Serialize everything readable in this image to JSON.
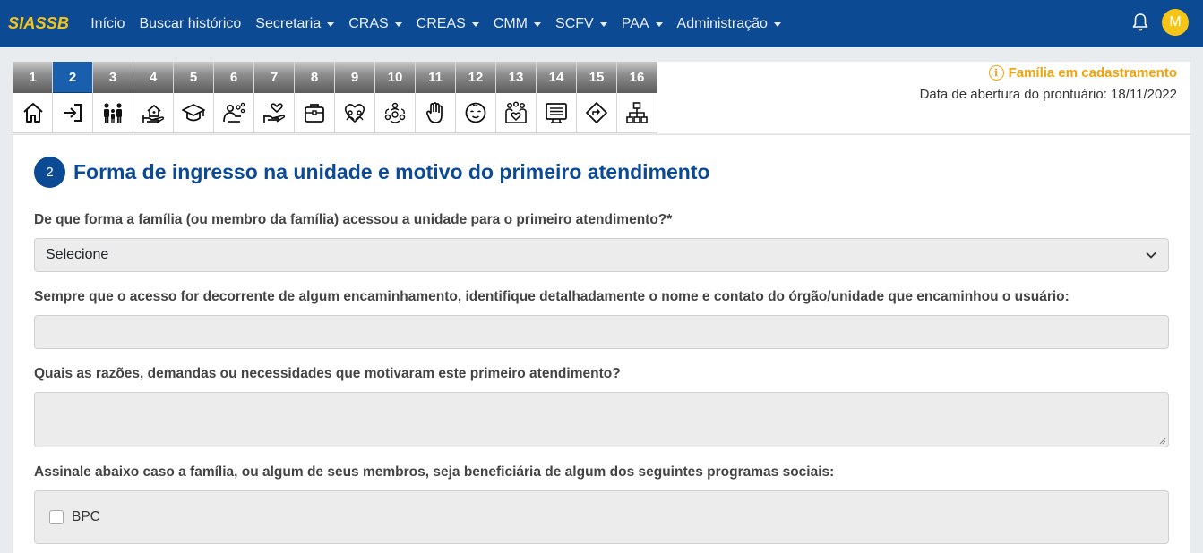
{
  "navbar": {
    "brand": "SIASSB",
    "items": [
      {
        "label": "Início",
        "dropdown": false
      },
      {
        "label": "Buscar histórico",
        "dropdown": false
      },
      {
        "label": "Secretaria",
        "dropdown": true
      },
      {
        "label": "CRAS",
        "dropdown": true
      },
      {
        "label": "CREAS",
        "dropdown": true
      },
      {
        "label": "CMM",
        "dropdown": true
      },
      {
        "label": "SCFV",
        "dropdown": true
      },
      {
        "label": "PAA",
        "dropdown": true
      },
      {
        "label": "Administração",
        "dropdown": true
      }
    ],
    "avatar_initial": "M",
    "bell_icon": "bell-icon"
  },
  "steps": [
    {
      "num": "1",
      "icon": "home-icon"
    },
    {
      "num": "2",
      "icon": "sign-in-icon",
      "active": true
    },
    {
      "num": "3",
      "icon": "family-icon"
    },
    {
      "num": "4",
      "icon": "house-hand-icon"
    },
    {
      "num": "5",
      "icon": "graduation-cap-icon"
    },
    {
      "num": "6",
      "icon": "health-icon"
    },
    {
      "num": "7",
      "icon": "hand-heart-icon"
    },
    {
      "num": "8",
      "icon": "briefcase-icon"
    },
    {
      "num": "9",
      "icon": "community-icon"
    },
    {
      "num": "10",
      "icon": "network-people-icon"
    },
    {
      "num": "11",
      "icon": "stop-hand-icon"
    },
    {
      "num": "12",
      "icon": "baby-face-icon"
    },
    {
      "num": "13",
      "icon": "people-heart-icon"
    },
    {
      "num": "14",
      "icon": "list-board-icon"
    },
    {
      "num": "15",
      "icon": "direction-sign-icon"
    },
    {
      "num": "16",
      "icon": "org-chart-icon"
    }
  ],
  "status": {
    "state": "Família em cadastramento",
    "date_label": "Data de abertura do prontuário: 18/11/2022",
    "accent": "#f0a30a"
  },
  "section": {
    "number": "2",
    "title": "Forma de ingresso na unidade e motivo do primeiro atendimento"
  },
  "form": {
    "q1_label": "De que forma a família (ou membro da família) acessou a unidade para o primeiro atendimento?*",
    "q1_value": "Selecione",
    "q2_label": "Sempre que o acesso for decorrente de algum encaminhamento, identifique detalhadamente o nome e contato do órgão/unidade que encaminhou o usuário:",
    "q2_value": "",
    "q3_label": "Quais as razões, demandas ou necessidades que motivaram este primeiro atendimento?",
    "q3_value": "",
    "q4_label": "Assinale abaixo caso a família, ou algum de seus membros, seja beneficiária de algum dos seguintes programas sociais:",
    "programs": [
      {
        "label": "BPC",
        "checked": false
      }
    ]
  },
  "colors": {
    "primary": "#0d4a94",
    "brand": "#f5c518"
  }
}
